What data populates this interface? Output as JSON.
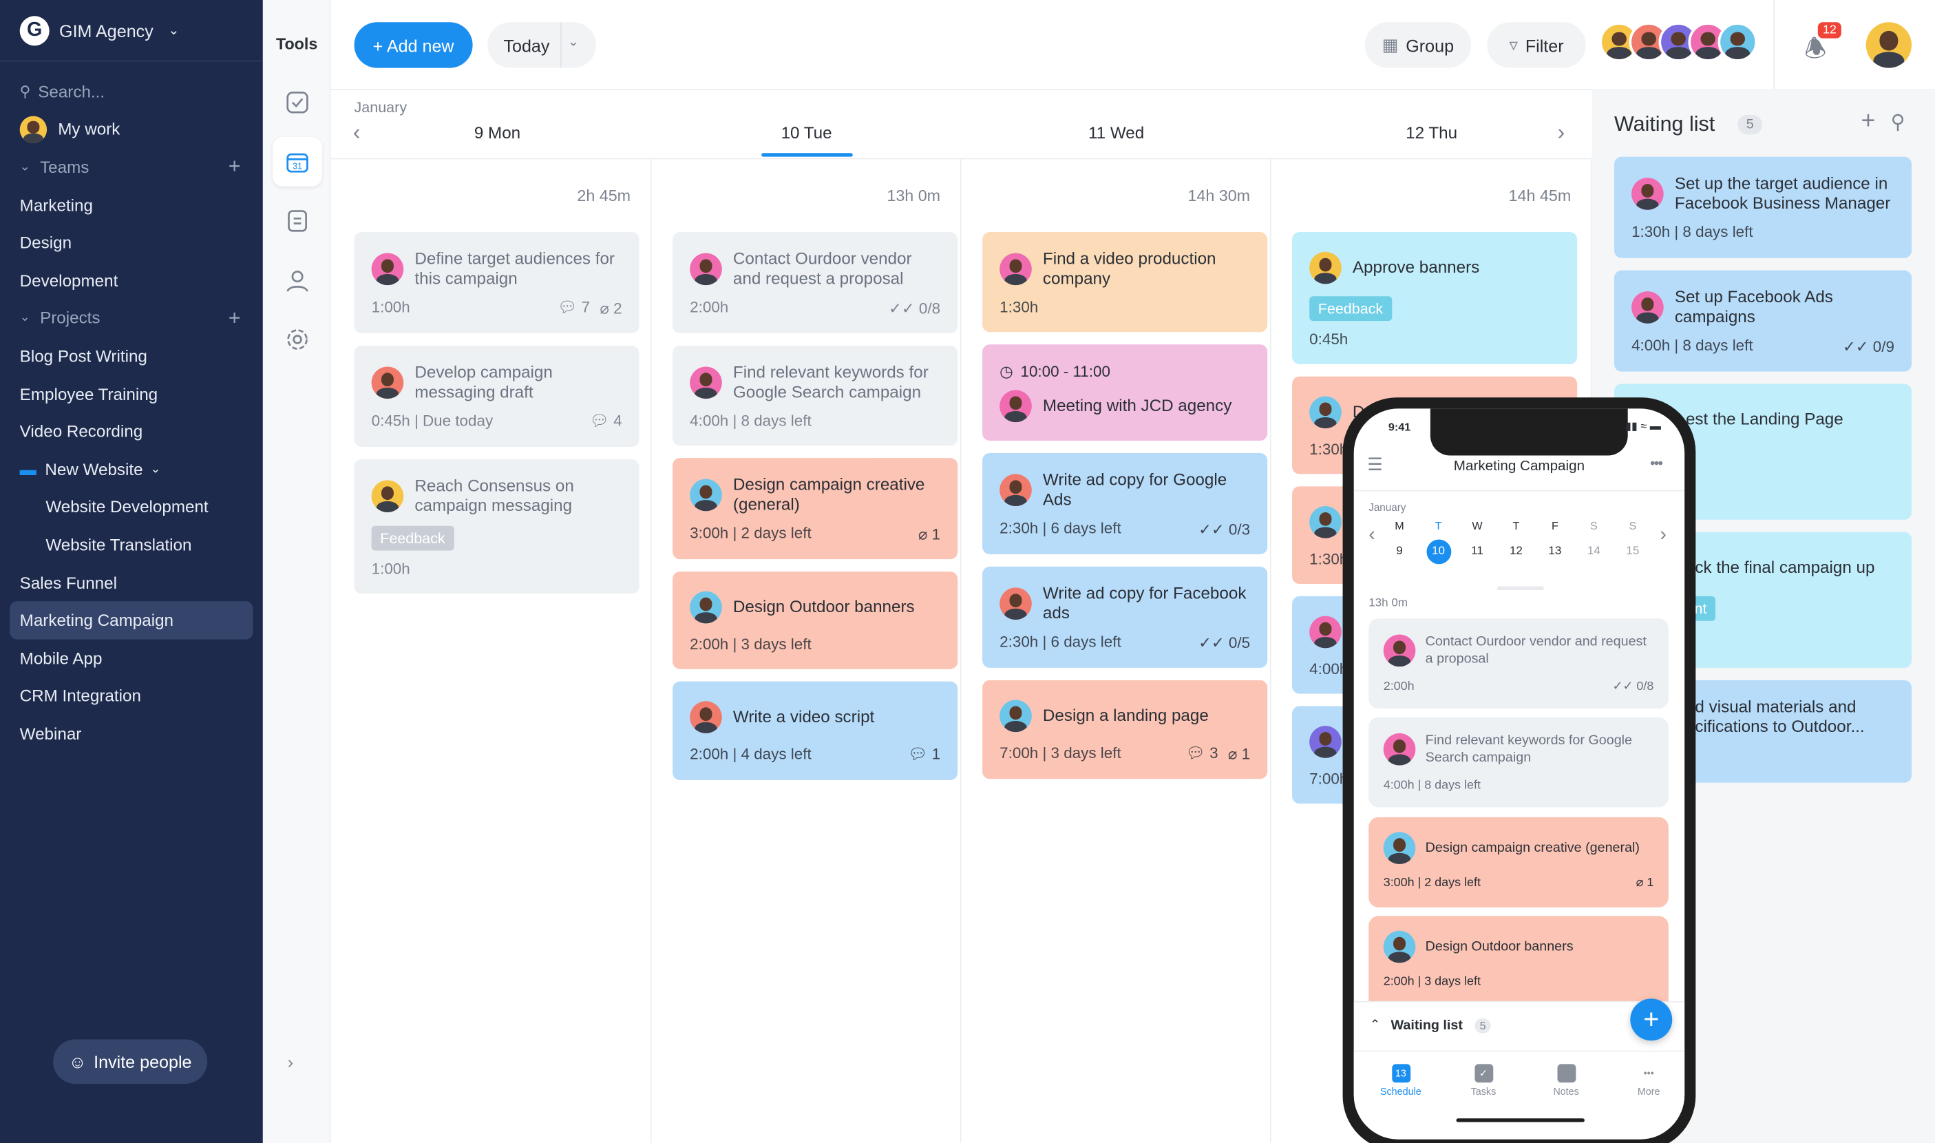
{
  "sidebar": {
    "workspace": "GIM Agency",
    "search_placeholder": "Search...",
    "my_work": "My work",
    "teams_label": "Teams",
    "teams": [
      "Marketing",
      "Design",
      "Development"
    ],
    "projects_label": "Projects",
    "projects": [
      "Blog Post Writing",
      "Employee Training",
      "Video Recording"
    ],
    "folder": "New Website",
    "folder_items": [
      "Website Development",
      "Website Translation"
    ],
    "projects_more": [
      "Sales Funnel",
      "Marketing Campaign",
      "Mobile App",
      "CRM Integration",
      "Webinar"
    ],
    "active": "Marketing Campaign",
    "invite": "Invite people"
  },
  "tools": {
    "title": "Tools",
    "icons": [
      "checkbox-icon",
      "calendar-icon",
      "notes-icon",
      "user-icon",
      "settings-icon"
    ],
    "calendar_day": "31"
  },
  "toolbar": {
    "add_new": "+ Add new",
    "today": "Today",
    "group": "Group",
    "filter": "Filter",
    "notifications": "12"
  },
  "colors": {
    "accent": "#1a8ff0",
    "sidebar": "#1d2a4b",
    "gray": "#eef1f4",
    "peach": "#fcdcb8",
    "salmon": "#fcc4b4",
    "blue": "#b7dcfa",
    "pink": "#f2bfe1",
    "cyan": "#c0eefa",
    "tag_gray": "#c9ced6",
    "tag_cyan": "#6fcfe6"
  },
  "calendar": {
    "month": "January",
    "days": [
      {
        "label": "9 Mon",
        "duration": "2h 45m",
        "cards": [
          {
            "title": "Define target audiences for this campaign",
            "meta": "1:00h",
            "comments": "7",
            "attachments": "2",
            "color": "gray",
            "avatar": "#f06bb0"
          },
          {
            "title": "Develop campaign messaging draft",
            "meta": "0:45h | Due today",
            "comments": "4",
            "color": "gray",
            "avatar": "#f07a6b"
          },
          {
            "title": "Reach Consensus on campaign messaging",
            "tag": "Feedback",
            "tagcolor": "tag_gray",
            "meta": "1:00h",
            "color": "gray",
            "avatar": "#f6c445"
          }
        ]
      },
      {
        "label": "10 Tue",
        "duration": "13h 0m",
        "active": true,
        "cards": [
          {
            "title": "Contact Ourdoor vendor and request a proposal",
            "meta": "2:00h",
            "checklist": "0/8",
            "color": "gray",
            "avatar": "#f06bb0"
          },
          {
            "title": "Find relevant keywords for Google Search campaign",
            "meta": "4:00h | 8 days left",
            "color": "gray",
            "avatar": "#f06bb0"
          },
          {
            "title": "Design campaign creative (general)",
            "meta": "3:00h | 2 days left",
            "attachments": "1",
            "color": "salmon",
            "avatar": "#6cc6ea"
          },
          {
            "title": "Design Outdoor banners",
            "meta": "2:00h | 3 days left",
            "color": "salmon",
            "avatar": "#6cc6ea"
          },
          {
            "title": "Write a video script",
            "meta": "2:00h | 4 days left",
            "comments": "1",
            "color": "blue",
            "avatar": "#f07a6b"
          }
        ]
      },
      {
        "label": "11 Wed",
        "duration": "14h 30m",
        "cards": [
          {
            "title": "Find a video production company",
            "meta": "1:30h",
            "color": "peach",
            "avatar": "#f06bb0"
          },
          {
            "time": "10:00 - 11:00",
            "title": "Meeting with JCD agency",
            "color": "pink",
            "avatar": "#f06bb0"
          },
          {
            "title": "Write ad copy for Google Ads",
            "meta": "2:30h | 6 days left",
            "checklist": "0/3",
            "color": "blue",
            "avatar": "#f07a6b"
          },
          {
            "title": "Write ad copy for Facebook ads",
            "meta": "2:30h | 6 days left",
            "checklist": "0/5",
            "color": "blue",
            "avatar": "#f07a6b"
          },
          {
            "title": "Design a landing page",
            "meta": "7:00h | 3 days left",
            "comments": "3",
            "attachments": "1",
            "color": "salmon",
            "avatar": "#6cc6ea"
          }
        ]
      },
      {
        "label": "12 Thu",
        "duration": "14h 45m",
        "cards": [
          {
            "title": "Approve banners",
            "tag": "Feedback",
            "tagcolor": "tag_cyan",
            "meta": "0:45h",
            "color": "cyan",
            "avatar": "#f6c445"
          },
          {
            "title": "D",
            "meta": "1:30h",
            "color": "salmon",
            "avatar": "#6cc6ea"
          },
          {
            "title": "",
            "meta": "1:30h",
            "color": "salmon",
            "avatar": "#6cc6ea"
          },
          {
            "title": "",
            "meta": "4:00h",
            "color": "blue",
            "avatar": "#f06bb0"
          },
          {
            "title": "",
            "meta": "7:00h",
            "color": "blue",
            "avatar": "#7a6be0"
          }
        ]
      }
    ]
  },
  "waiting_list": {
    "title": "Waiting list",
    "count": "5",
    "cards": [
      {
        "title": "Set up the target audience in Facebook Business Manager",
        "meta": "1:30h | 8 days left",
        "color": "blue",
        "avatar": "#f06bb0"
      },
      {
        "title": "Set up Facebook Ads campaigns",
        "meta": "4:00h | 8 days left",
        "checklist": "0/9",
        "color": "blue",
        "avatar": "#f06bb0"
      },
      {
        "title": "est the Landing Page",
        "color": "cyan"
      },
      {
        "title": "eck the final campaign up",
        "tag": "nt",
        "color": "cyan"
      },
      {
        "title": "nd visual materials and ecifications to Outdoor...",
        "color": "blue"
      }
    ]
  },
  "phone": {
    "clock": "9:41",
    "title": "Marketing Campaign",
    "month": "January",
    "weekdays": [
      "M",
      "T",
      "W",
      "T",
      "F",
      "S",
      "S"
    ],
    "dates": [
      "9",
      "10",
      "11",
      "12",
      "13",
      "14",
      "15"
    ],
    "selected": "10",
    "duration": "13h 0m",
    "cards": [
      {
        "title": "Contact Ourdoor vendor and request a proposal",
        "meta": "2:00h",
        "checklist": "0/8",
        "color": "gray",
        "avatar": "#f06bb0"
      },
      {
        "title": "Find relevant keywords for Google Search campaign",
        "meta": "4:00h | 8 days left",
        "color": "gray",
        "avatar": "#f06bb0"
      },
      {
        "title": "Design campaign creative (general)",
        "meta": "3:00h | 2 days left",
        "attachments": "1",
        "color": "salmon",
        "avatar": "#6cc6ea"
      },
      {
        "title": "Design Outdoor banners",
        "meta": "2:00h | 3 days left",
        "color": "salmon",
        "avatar": "#6cc6ea"
      }
    ],
    "waiting_label": "Waiting list",
    "waiting_count": "5",
    "tabs": [
      {
        "label": "Schedule",
        "icon": "calendar-icon",
        "badge": "13",
        "active": true
      },
      {
        "label": "Tasks",
        "icon": "tasks-icon"
      },
      {
        "label": "Notes",
        "icon": "notes-icon"
      },
      {
        "label": "More",
        "icon": "more-icon"
      }
    ]
  }
}
